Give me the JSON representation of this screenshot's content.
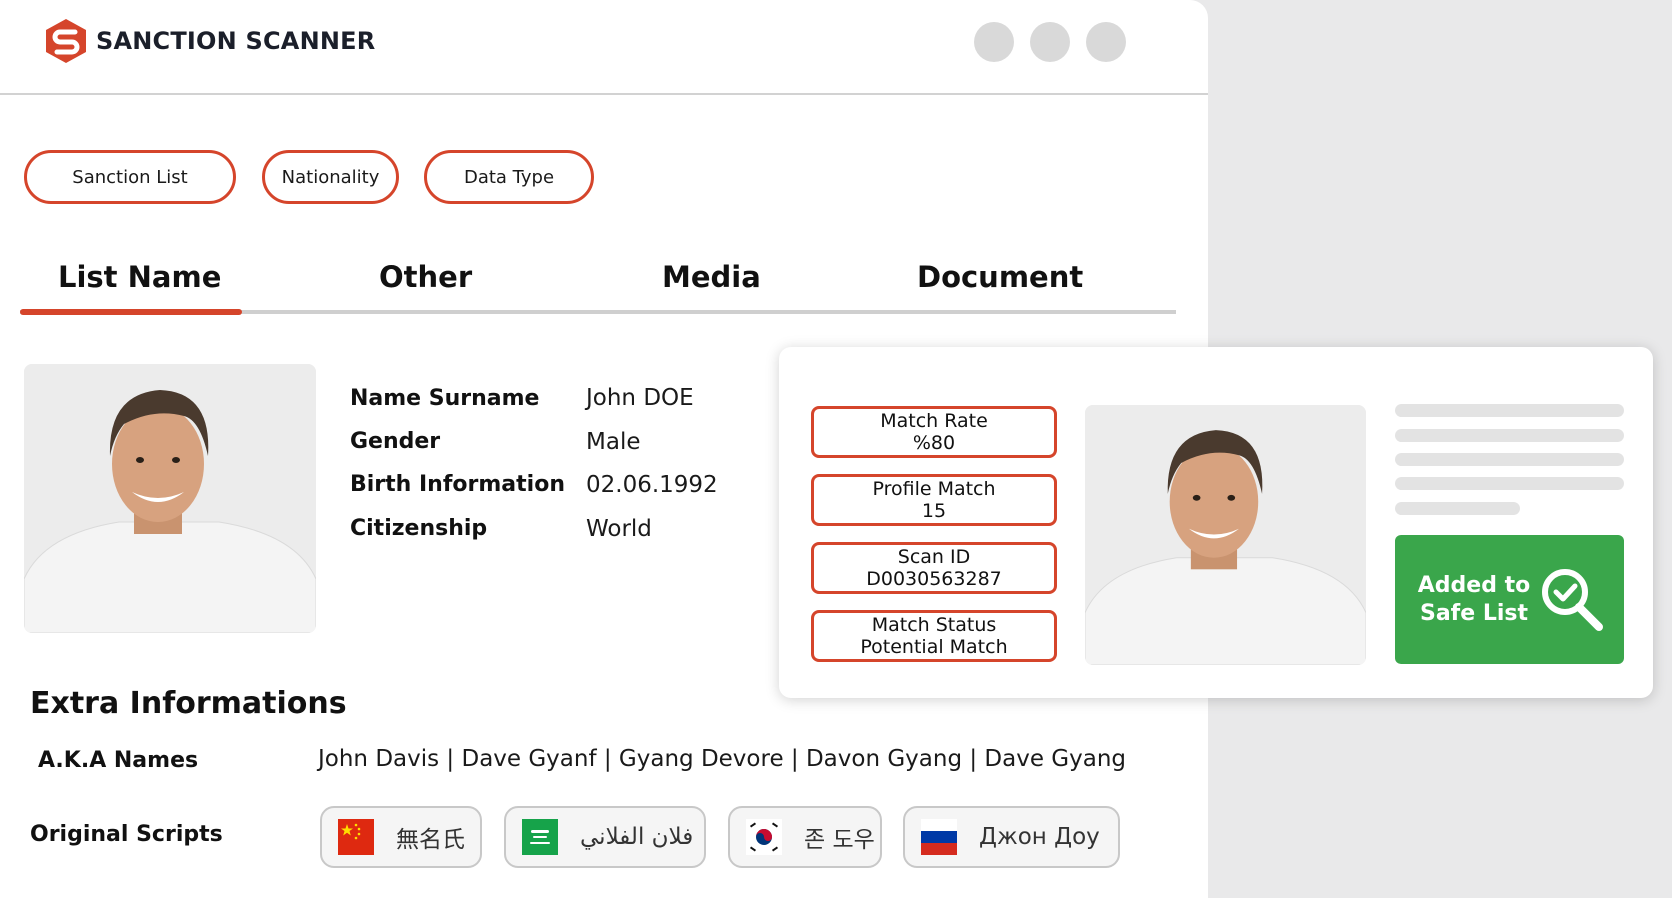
{
  "app": {
    "brand": "SANCTION SCANNER"
  },
  "colors": {
    "accent": "#d5452b",
    "success": "#3aa64b",
    "skeleton": "#e3e3e3",
    "window_dot": "#d9d9d9"
  },
  "filters": [
    {
      "label": "Sanction List"
    },
    {
      "label": "Nationality"
    },
    {
      "label": "Data Type"
    }
  ],
  "tabs": [
    {
      "label": "List Name",
      "active": true
    },
    {
      "label": "Other",
      "active": false
    },
    {
      "label": "Media",
      "active": false
    },
    {
      "label": "Document",
      "active": false
    }
  ],
  "profile": {
    "rows": [
      {
        "label": "Name Surname",
        "value": "John DOE"
      },
      {
        "label": "Gender",
        "value": "Male"
      },
      {
        "label": "Birth Information",
        "value": "02.06.1992"
      },
      {
        "label": "Citizenship",
        "value": "World"
      }
    ]
  },
  "match": {
    "stats": [
      {
        "label": "Match Rate",
        "value": "%80"
      },
      {
        "label": "Profile Match",
        "value": "15"
      },
      {
        "label": "Scan ID",
        "value": "D0030563287"
      },
      {
        "label": "Match Status",
        "value": "Potential Match"
      }
    ],
    "safe_button": {
      "line1": "Added to",
      "line2": "Safe List",
      "icon": "search-check-icon"
    }
  },
  "extra": {
    "title": "Extra Informations",
    "aka_label": "A.K.A Names",
    "aka_values": "John Davis  | Dave Gyanf |  Gyang Devore | Davon Gyang | Dave Gyang",
    "scripts_label": "Original Scripts",
    "scripts": [
      {
        "flag": "china-flag-icon",
        "text": "無名氏"
      },
      {
        "flag": "saudi-flag-icon",
        "text": "فلان الفلاني"
      },
      {
        "flag": "korea-flag-icon",
        "text": "존 도우"
      },
      {
        "flag": "russia-flag-icon",
        "text": "Джон Доу"
      }
    ]
  }
}
